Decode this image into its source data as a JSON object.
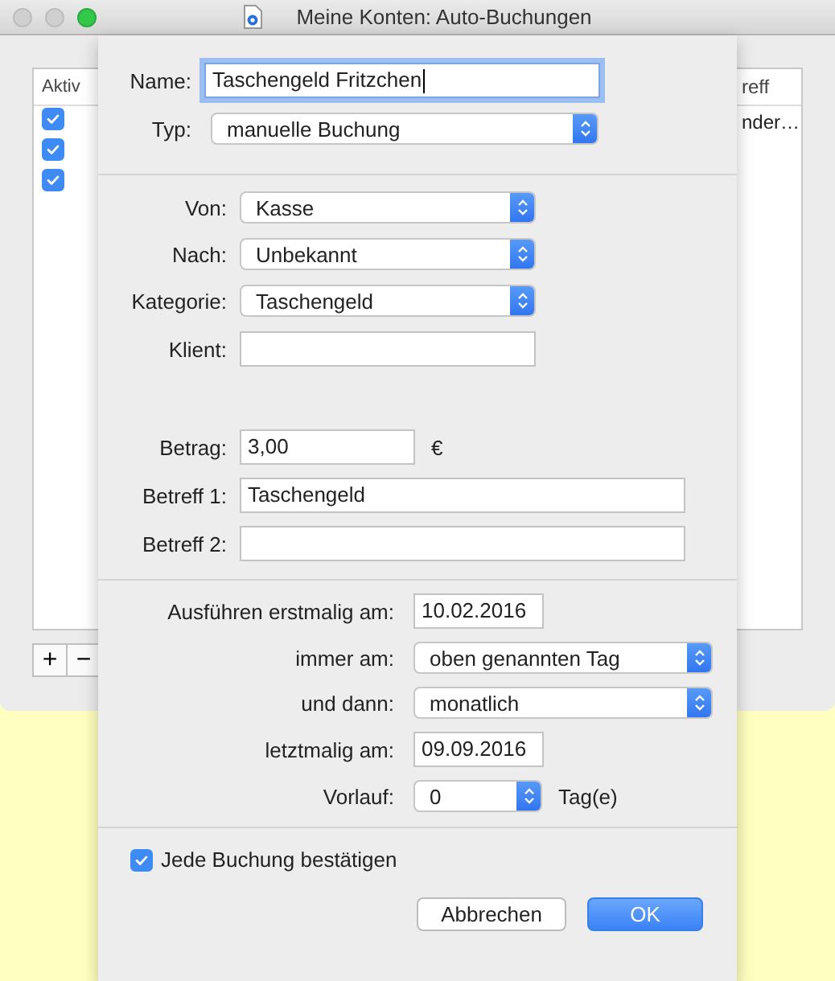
{
  "window": {
    "title": "Meine Konten: Auto-Buchungen"
  },
  "table": {
    "columns": [
      {
        "label": "Aktiv"
      },
      {
        "label": "reff"
      }
    ],
    "rows": [
      {
        "active": true,
        "column_2": "nder…"
      },
      {
        "active": true
      },
      {
        "active": true
      }
    ]
  },
  "table_buttons": [
    "+",
    "−"
  ],
  "sheet": {
    "sections": [
      {
        "groups": [
          [
            {
              "kind": "text",
              "label": "Name:",
              "value": "Taschengeld Fritzchen",
              "focused": true
            },
            {
              "kind": "popup",
              "label": "Typ:",
              "value": "manuelle Buchung"
            }
          ]
        ]
      },
      {
        "groups": [
          [
            {
              "kind": "popup",
              "label": "Von:",
              "value": "Kasse"
            },
            {
              "kind": "popup",
              "label": "Nach:",
              "value": "Unbekannt"
            },
            {
              "kind": "popup",
              "label": "Kategorie:",
              "value": "Taschengeld"
            },
            {
              "kind": "text",
              "label": "Klient:"
            }
          ],
          [
            {
              "kind": "text",
              "label": "Betrag:",
              "value": "3,00",
              "suffix": "€"
            },
            {
              "kind": "text",
              "label": "Betreff 1:",
              "value": "Taschengeld"
            },
            {
              "kind": "text",
              "label": "Betreff 2:"
            }
          ]
        ]
      },
      {
        "groups": [
          [
            {
              "kind": "text",
              "label": "Ausführen erstmalig am:",
              "value": "10.02.2016"
            },
            {
              "kind": "popup",
              "label": "immer am:",
              "value": "oben genannten Tag"
            },
            {
              "kind": "popup",
              "label": "und dann:",
              "value": "monatlich"
            },
            {
              "kind": "text",
              "label": "letztmalig am:",
              "value": "09.09.2016"
            },
            {
              "kind": "popup",
              "label": "Vorlauf:",
              "value": "0",
              "suffix": "Tag(e)"
            }
          ]
        ]
      }
    ],
    "checkbox": {
      "label": "Jede Buchung bestätigen",
      "checked": true
    },
    "buttons": [
      {
        "label": "Abbrechen",
        "default": false
      },
      {
        "label": "OK",
        "default": true
      }
    ]
  }
}
